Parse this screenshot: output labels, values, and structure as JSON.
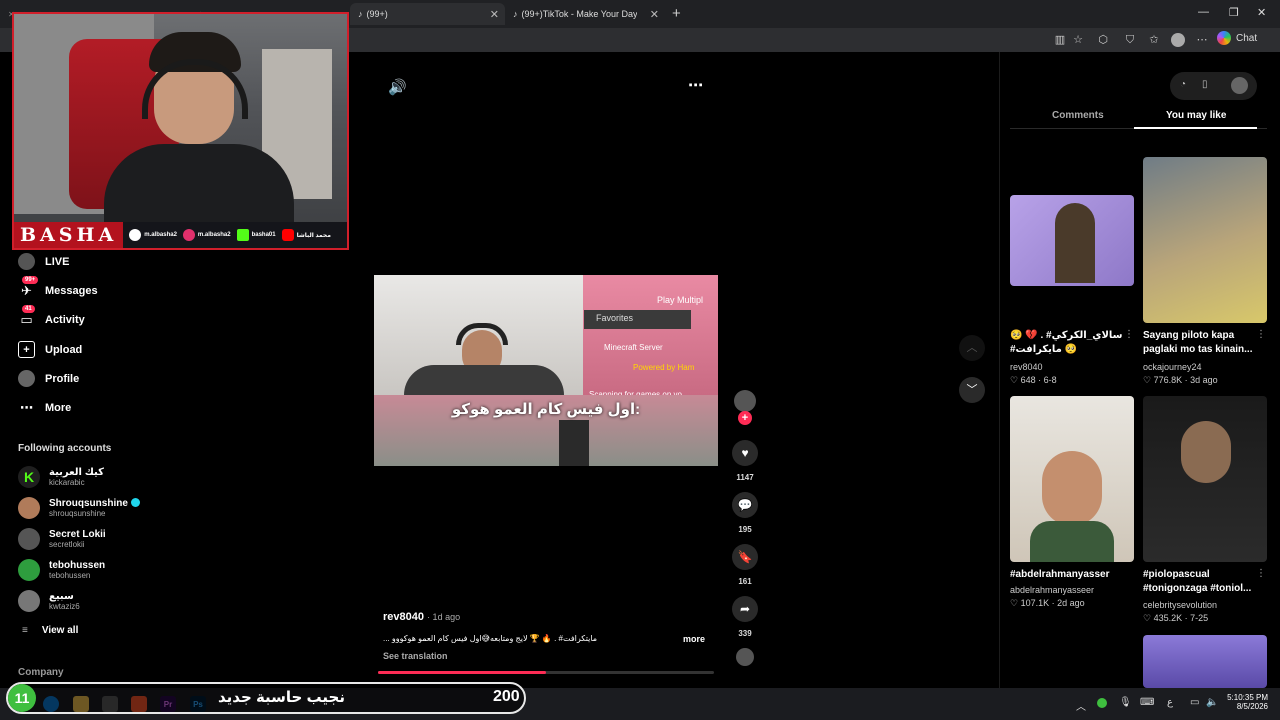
{
  "browser": {
    "tabs": [
      {
        "label": "(99+)"
      },
      {
        "label": "(99+)TikTok - Make Your Day"
      }
    ],
    "new_tab_symbol": "+",
    "chat_label": "Chat",
    "window_controls": [
      "—",
      "❐",
      "✕"
    ]
  },
  "webcam": {
    "brand": "BASHA",
    "socials": [
      {
        "handle": "m.albasha2",
        "color": "#ffffff",
        "icon": "tiktok-icon"
      },
      {
        "handle": "m.albasha2",
        "color": "#e1306c",
        "icon": "instagram-icon"
      },
      {
        "handle": "basha01",
        "color": "#53fc18",
        "icon": "kick-icon"
      },
      {
        "handle": "محمد الباشا",
        "color": "#ff0000",
        "icon": "youtube-icon"
      }
    ]
  },
  "sidebar": {
    "items": [
      {
        "label": "LIVE",
        "icon": "live-icon"
      },
      {
        "label": "Messages",
        "icon": "messages-icon",
        "badge": "99+"
      },
      {
        "label": "Activity",
        "icon": "activity-icon",
        "badge": "41"
      },
      {
        "label": "Upload",
        "icon": "upload-icon"
      },
      {
        "label": "Profile",
        "icon": "profile-icon"
      },
      {
        "label": "More",
        "icon": "more-icon"
      }
    ],
    "following_heading": "Following accounts",
    "accounts": [
      {
        "name": "كيك العربية",
        "username": "kickarabic",
        "color": "#1f1f1f"
      },
      {
        "name": "Shrouqsunshine",
        "username": "shrouqsunshine",
        "verified": true,
        "color": "#b07b5a"
      },
      {
        "name": "Secret Lokii",
        "username": "secretlokii",
        "color": "#555"
      },
      {
        "name": "tebohussen",
        "username": "tebohussen",
        "color": "#2e9d3e"
      },
      {
        "name": "سبيع",
        "username": "kwtaziz6",
        "color": "#777"
      }
    ],
    "view_all": "View all",
    "company": "Company"
  },
  "video": {
    "caption_overlay": "اول فيس كام العمو هوكو:",
    "game_menu": [
      "Play Multipl",
      "Favorites",
      "Minecraft Server",
      "Powered by Ham",
      "Scanning for games on yo"
    ],
    "author": "rev8040",
    "age": "· 1d ago",
    "description": "... مايتكرافت# . 🔥 🏆 لايج ومتابعه😅اول فيس كام العمو هوكووو",
    "more": "more",
    "see_translation": "See translation",
    "progress": 0.5
  },
  "actions": {
    "likes": "1147",
    "comments": "195",
    "saves": "161",
    "shares": "339"
  },
  "right_panel": {
    "tabs": [
      "Comments",
      "You may like"
    ],
    "active_tab": "You may like",
    "cards": [
      {
        "title": "سالاي_الكركي# . 💔 🥺 🥺 مايكرافت#",
        "user": "rev8040",
        "stats": "♡ 648 · 6-8"
      },
      {
        "title": "Sayang piloto kapa paglaki mo tas kinain...",
        "user": "ockajourney24",
        "stats": "♡ 776.8K · 3d ago"
      },
      {
        "title": "#abdelrahmanyasser",
        "user": "abdelrahmanyasseer",
        "stats": "♡ 107.1K · 2d ago"
      },
      {
        "title": "#piolopascual #tonigonzaga #toniol...",
        "user": "celebritysevolution",
        "stats": "♡ 435.2K · 7-25"
      }
    ]
  },
  "stream_overlay": {
    "level": "11",
    "goal_text": "نجيب حاسبة جديد",
    "goal_count": "200"
  },
  "taskbar": {
    "time": "5:10:35 PM",
    "date": "8/5/2026",
    "lang": "ع"
  }
}
